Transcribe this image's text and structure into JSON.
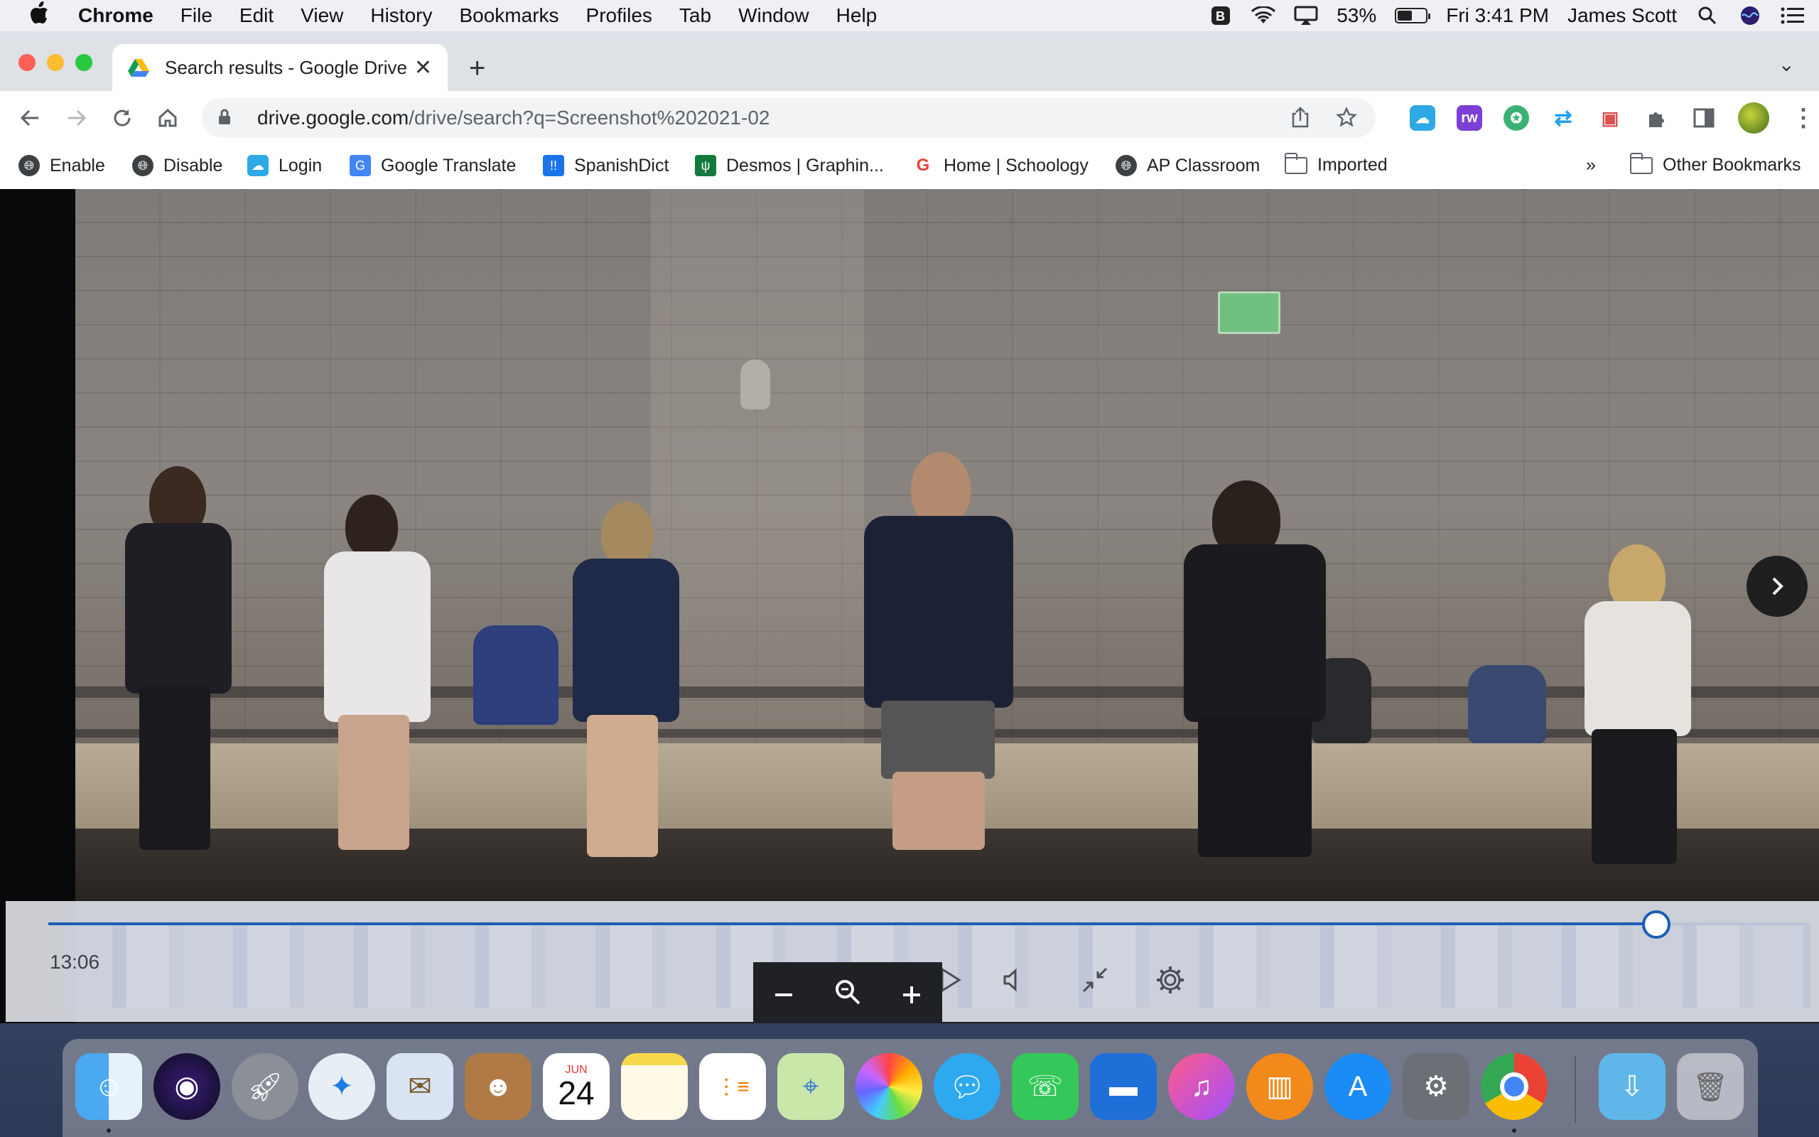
{
  "menubar": {
    "app_name": "Chrome",
    "menus": [
      "File",
      "Edit",
      "View",
      "History",
      "Bookmarks",
      "Profiles",
      "Tab",
      "Window",
      "Help"
    ],
    "battery_percent": "53%",
    "battery_level": 0.53,
    "clock": "Fri 3:41 PM",
    "user": "James Scott"
  },
  "browser": {
    "tab": {
      "title": "Search results - Google Drive"
    },
    "omnibox": {
      "host": "drive.google.com",
      "path": "/drive/search?q=Screenshot%202021-02"
    },
    "bookmarks": [
      {
        "label": "Enable",
        "icon": "globe-icon"
      },
      {
        "label": "Disable",
        "icon": "globe-icon"
      },
      {
        "label": "Login",
        "icon": "cloud-icon"
      },
      {
        "label": "Google Translate",
        "icon": "translate-icon"
      },
      {
        "label": "SpanishDict",
        "icon": "spanishdict-icon"
      },
      {
        "label": "Desmos | Graphin...",
        "icon": "desmos-icon"
      },
      {
        "label": "Home | Schoology",
        "icon": "google-icon"
      },
      {
        "label": "AP Classroom",
        "icon": "globe-icon"
      },
      {
        "label": "Imported",
        "icon": "folder-icon"
      }
    ],
    "overflow": "»",
    "other_bookmarks": "Other Bookmarks"
  },
  "player": {
    "current_time": "13:06",
    "progress": 0.916
  },
  "colors": {
    "accent": "#1a5fb4",
    "chrome_tabstrip": "#dee1e6",
    "zoom_bar": "#202124"
  },
  "dock": {
    "apps": [
      "Finder",
      "Siri",
      "Launchpad",
      "Safari",
      "Mail",
      "Contacts",
      "Calendar",
      "Notes",
      "Reminders",
      "Maps",
      "Photos",
      "Messages",
      "FaceTime",
      "Keynote",
      "iTunes",
      "Books",
      "App Store",
      "System Preferences",
      "Google Chrome",
      "Downloads",
      "Trash"
    ],
    "calendar_month": "JUN",
    "calendar_day": "24"
  }
}
